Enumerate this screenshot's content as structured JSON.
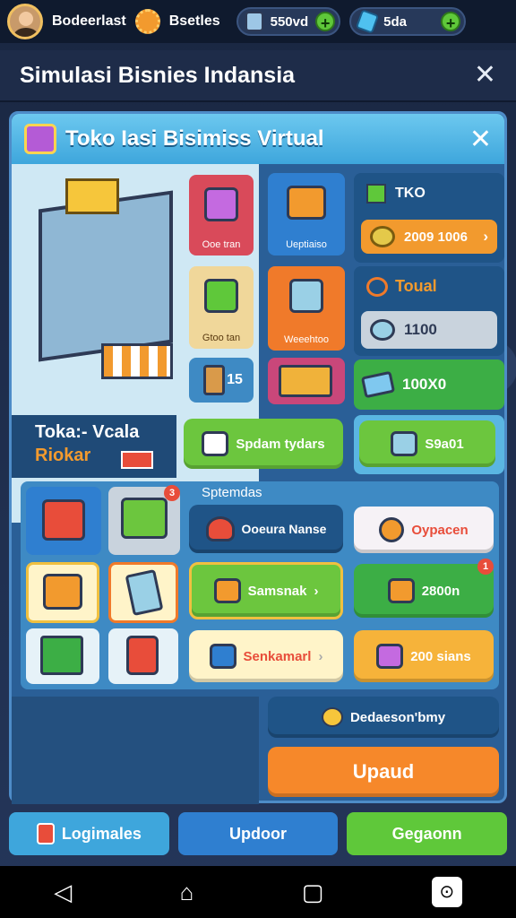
{
  "statusbar": {
    "player_name": "Bodeerlast",
    "gear_label": "Bsetles",
    "currency1": "550vd",
    "currency2": "5da"
  },
  "header": {
    "title": "Simulasi Bisnies Indansia"
  },
  "panel": {
    "title": "Toko Iasi Bisimiss Virtual",
    "tiles": {
      "t1": "Ooe tran",
      "t2": "Ueptiaiso",
      "t3": "Gtoo tan",
      "t4": "Weeehtoo",
      "t5": "15"
    },
    "stats": {
      "tko_label": "TKO",
      "tko_value": "2009 1006",
      "toual_label": "Toual",
      "toual_value": "1100",
      "green_value": "100X0"
    },
    "store_name_line1": "Toka:- Vcala",
    "store_name_line2": "Riokar",
    "btn_spdam": "Spdam tydars",
    "btn_s9a01": "S9a01",
    "section_label": "Sptemdas",
    "btn_ocura": "Ooeura Nanse",
    "btn_oypacen": "Oypacen",
    "btn_samsnak": "Samsnak",
    "btn_2800n": "2800n",
    "btn_senkamarl": "Senkamarl",
    "btn_200sians": "200 sians",
    "badge1": "3",
    "badge2": "1",
    "dedaeson": "Dedaeson'bmy",
    "upaud": "Upaud"
  },
  "bottom": {
    "btn1": "Logimales",
    "btn2": "Updoor",
    "btn3": "Gegaonn"
  },
  "colors": {
    "green": "#5fc83a",
    "orange": "#f29a2e",
    "blue": "#2f7fd0",
    "teal": "#3ea6dc",
    "red": "#e84d3a"
  }
}
